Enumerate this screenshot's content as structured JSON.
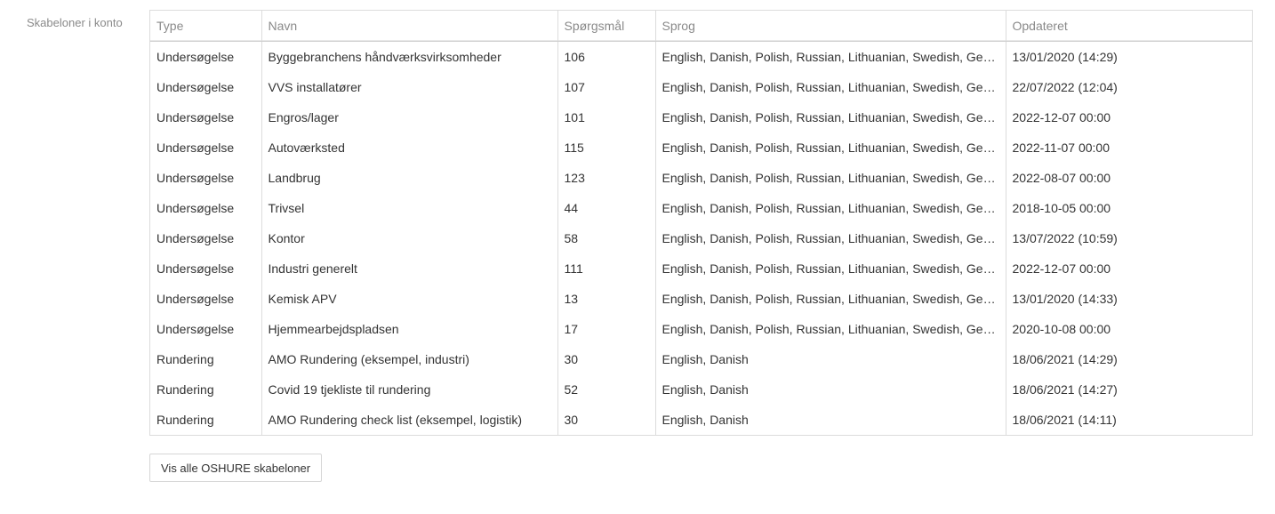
{
  "section": {
    "label": "Skabeloner i konto"
  },
  "table": {
    "headers": [
      "Type",
      "Navn",
      "Spørgsmål",
      "Sprog",
      "Opdateret"
    ],
    "rows": [
      [
        "Undersøgelse",
        "Byggebranchens håndværksvirksomheder",
        "106",
        "English, Danish, Polish, Russian, Lithuanian, Swedish, German",
        "13/01/2020 (14:29)"
      ],
      [
        "Undersøgelse",
        "VVS installatører",
        "107",
        "English, Danish, Polish, Russian, Lithuanian, Swedish, German",
        "22/07/2022 (12:04)"
      ],
      [
        "Undersøgelse",
        "Engros/lager",
        "101",
        "English, Danish, Polish, Russian, Lithuanian, Swedish, German",
        "2022-12-07 00:00"
      ],
      [
        "Undersøgelse",
        "Autoværksted",
        "115",
        "English, Danish, Polish, Russian, Lithuanian, Swedish, German",
        "2022-11-07 00:00"
      ],
      [
        "Undersøgelse",
        "Landbrug",
        "123",
        "English, Danish, Polish, Russian, Lithuanian, Swedish, German",
        "2022-08-07 00:00"
      ],
      [
        "Undersøgelse",
        "Trivsel",
        "44",
        "English, Danish, Polish, Russian, Lithuanian, Swedish, German",
        "2018-10-05 00:00"
      ],
      [
        "Undersøgelse",
        "Kontor",
        "58",
        "English, Danish, Polish, Russian, Lithuanian, Swedish, German",
        "13/07/2022 (10:59)"
      ],
      [
        "Undersøgelse",
        "Industri generelt",
        "111",
        "English, Danish, Polish, Russian, Lithuanian, Swedish, German",
        "2022-12-07 00:00"
      ],
      [
        "Undersøgelse",
        "Kemisk APV",
        "13",
        "English, Danish, Polish, Russian, Lithuanian, Swedish, German",
        "13/01/2020 (14:33)"
      ],
      [
        "Undersøgelse",
        "Hjemmearbejdspladsen",
        "17",
        "English, Danish, Polish, Russian, Lithuanian, Swedish, German",
        "2020-10-08 00:00"
      ],
      [
        "Rundering",
        "AMO Rundering (eksempel, industri)",
        "30",
        "English, Danish",
        "18/06/2021 (14:29)"
      ],
      [
        "Rundering",
        "Covid 19 tjekliste til rundering",
        "52",
        "English, Danish",
        "18/06/2021 (14:27)"
      ],
      [
        "Rundering",
        "AMO Rundering check list (eksempel, logistik)",
        "30",
        "English, Danish",
        "18/06/2021 (14:11)"
      ]
    ]
  },
  "actions": {
    "show_all_label": "Vis alle OSHURE skabeloner"
  }
}
